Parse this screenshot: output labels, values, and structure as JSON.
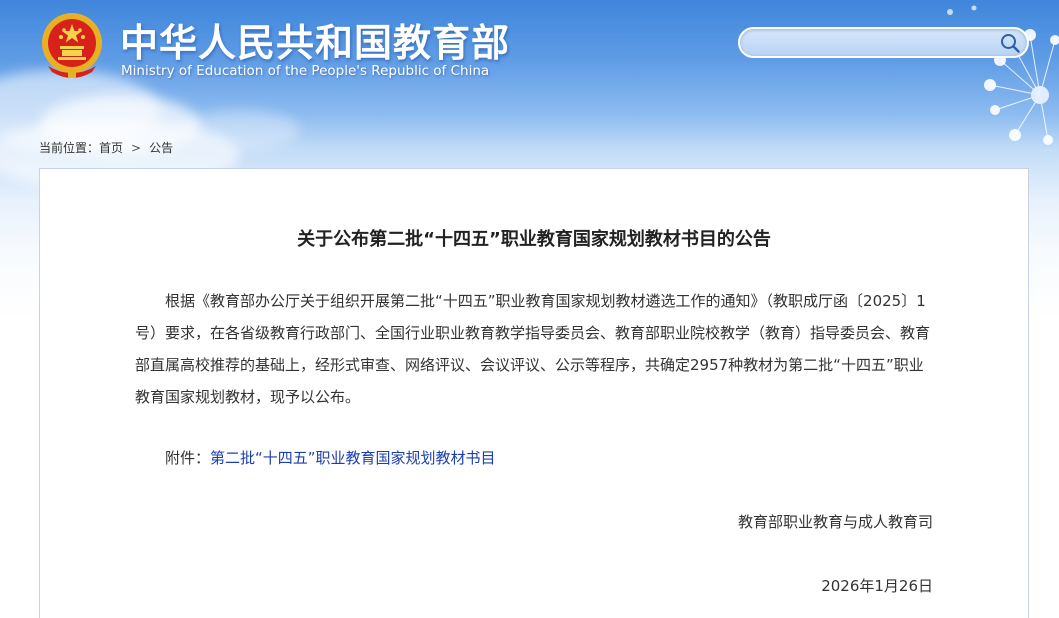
{
  "header": {
    "title_cn": "中华人民共和国教育部",
    "title_en": "Ministry of Education of the People's Republic of China",
    "search": {
      "placeholder": "",
      "value": ""
    },
    "icons": {
      "emblem": "national-emblem-icon",
      "search": "search-icon"
    }
  },
  "breadcrumb": {
    "prefix": "当前位置：",
    "items": [
      "首页",
      "公告"
    ],
    "separator": ">"
  },
  "article": {
    "title": "关于公布第二批“十四五”职业教育国家规划教材书目的公告",
    "body": "根据《教育部办公厅关于组织开展第二批“十四五”职业教育国家规划教材遴选工作的通知》（教职成厅函〔2025〕1号）要求，在各省级教育行政部门、全国行业职业教育教学指导委员会、教育部职业院校教学（教育）指导委员会、教育部直属高校推荐的基础上，经形式审查、网络评议、会议评议、公示等程序，共确定2957种教材为第二批“十四五”职业教育国家规划教材，现予以公布。",
    "attachment_label": "附件：",
    "attachment_link": "第二批“十四五”职业教育国家规划教材书目",
    "signature": "教育部职业教育与成人教育司",
    "date": "2026年1月26日"
  },
  "colors": {
    "header_blue": "#3f86dc",
    "link_blue": "#1b3fae",
    "text": "#333333",
    "box_border": "#c9d3df"
  }
}
